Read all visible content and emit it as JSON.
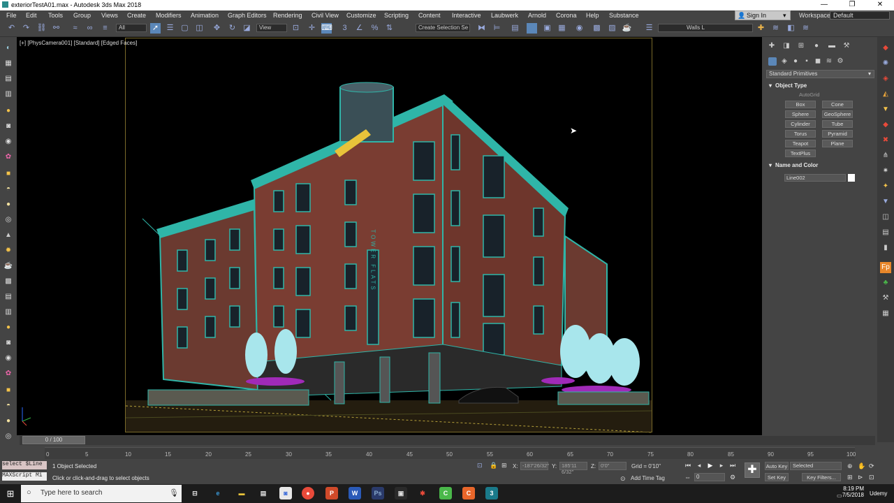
{
  "window": {
    "title": "exteriorTestA01.max - Autodesk 3ds Max 2018",
    "minimize": "—",
    "maximize": "❐",
    "close": "✕"
  },
  "menu": [
    "File",
    "Edit",
    "Tools",
    "Group",
    "Views",
    "Create",
    "Modifiers",
    "Animation",
    "Graph Editors",
    "Rendering",
    "Civil View",
    "Customize",
    "Scripting",
    "Content",
    "Interactive",
    "Laubwerk",
    "Arnold",
    "Corona",
    "Help",
    "Substance"
  ],
  "account": {
    "sign_in": "Sign In",
    "workspaces_label": "Workspaces:",
    "workspace": "Default"
  },
  "toolbar": {
    "selection_filter": "All",
    "ref_coord": "View",
    "selection_set": "Create Selection Se",
    "layer": "Walls L"
  },
  "viewport": {
    "label": "[+] [PhysCamera001] [Standard] [Edged Faces]",
    "sign_text": "TOWER FLATS"
  },
  "command_panel": {
    "category": "Standard Primitives",
    "object_type_title": "Object Type",
    "autogrid": "AutoGrid",
    "object_buttons": [
      "Box",
      "Cone",
      "Sphere",
      "GeoSphere",
      "Cylinder",
      "Tube",
      "Torus",
      "Pyramid",
      "Teapot",
      "Plane",
      "TextPlus"
    ],
    "name_color_title": "Name and Color",
    "object_name": "Line002",
    "object_color": "#ffffff"
  },
  "timeline": {
    "frame_display": "0 / 100",
    "ticks": [
      "0",
      "5",
      "10",
      "15",
      "20",
      "25",
      "30",
      "35",
      "40",
      "45",
      "50",
      "55",
      "60",
      "65",
      "70",
      "75",
      "80",
      "85",
      "90",
      "95",
      "100"
    ]
  },
  "status": {
    "maxscript_line1": "select $Line",
    "maxscript_line2": "MAXScript Mi",
    "selection_info": "1 Object Selected",
    "prompt": "Click or click-and-drag to select objects",
    "x_label": "X:",
    "x_value": "-187'26/32\"",
    "y_label": "Y:",
    "y_value": "185'11 6/32\"",
    "z_label": "Z:",
    "z_value": "0'0\"",
    "grid": "Grid = 0'10\"",
    "add_time_tag": "Add Time Tag",
    "current_frame": "0",
    "auto_key": "Auto Key",
    "set_key": "Set Key",
    "key_mode": "Selected",
    "key_filters": "Key Filters..."
  },
  "taskbar": {
    "search_placeholder": "Type here to search",
    "time": "8:19 PM",
    "date": "7/5/2018",
    "watermark": "Udemy"
  },
  "colors": {
    "wire": "#2fb5a8",
    "brick": "#7a3d32",
    "tree": "#a8e6ec",
    "flowers": "#a02ab8",
    "water_tower": "#3a4f56"
  }
}
